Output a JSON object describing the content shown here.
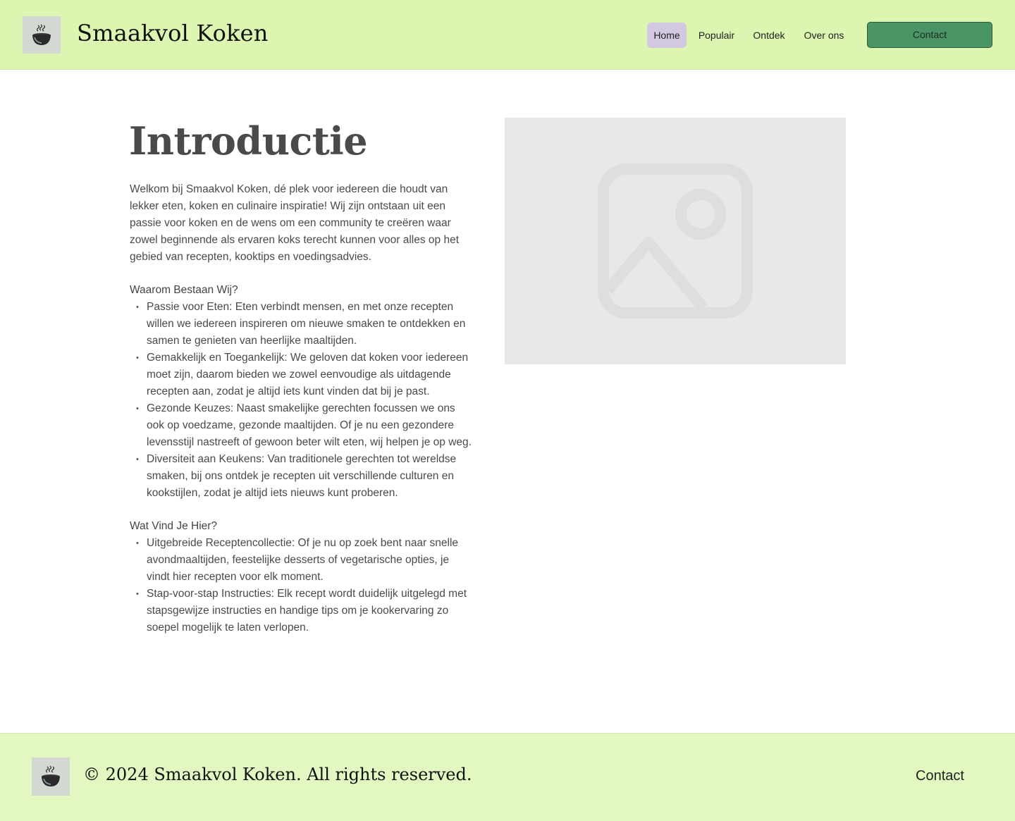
{
  "header": {
    "brand": "Smaakvol Koken",
    "logo_icon": "steaming-bowl-icon",
    "nav": [
      {
        "label": "Home",
        "active": true
      },
      {
        "label": "Populair",
        "active": false
      },
      {
        "label": "Ontdek",
        "active": false
      },
      {
        "label": "Over ons",
        "active": false
      }
    ],
    "contact_label": "Contact"
  },
  "main": {
    "title": "Introductie",
    "intro": "Welkom bij Smaakvol Koken, dé plek voor iedereen die houdt van lekker eten, koken en culinaire inspiratie! Wij zijn ontstaan uit een passie voor koken en de wens om een community te creëren waar zowel beginnende als ervaren koks terecht kunnen voor alles op het gebied van recepten, kooktips en voedingsadvies.",
    "section1": {
      "heading": "Waarom Bestaan Wij?",
      "items": [
        "Passie voor Eten: Eten verbindt mensen, en met onze recepten willen we iedereen inspireren om nieuwe smaken te ontdekken en samen te genieten van heerlijke maaltijden.",
        "Gemakkelijk en Toegankelijk: We geloven dat koken voor iedereen moet zijn, daarom bieden we zowel eenvoudige als uitdagende recepten aan, zodat je altijd iets kunt vinden dat bij je past.",
        "Gezonde Keuzes: Naast smakelijke gerechten focussen we ons ook op voedzame, gezonde maaltijden. Of je nu een gezondere levensstijl nastreeft of gewoon beter wilt eten, wij helpen je op weg.",
        "Diversiteit aan Keukens: Van traditionele gerechten tot wereldse smaken, bij ons ontdek je recepten uit verschillende culturen en kookstijlen, zodat je altijd iets nieuws kunt proberen."
      ]
    },
    "section2": {
      "heading": "Wat Vind Je Hier?",
      "items": [
        "Uitgebreide Receptencollectie: Of je nu op zoek bent naar snelle avondmaaltijden, feestelijke desserts of vegetarische opties, je vindt hier recepten voor elk moment.",
        "Stap-voor-stap Instructies: Elk recept wordt duidelijk uitgelegd met stapsgewijze instructies en handige tips om je kookervaring zo soepel mogelijk te laten verlopen."
      ]
    },
    "image_icon": "image-placeholder-icon"
  },
  "footer": {
    "copyright": "© 2024 Smaakvol Koken. All rights reserved.",
    "contact_label": "Contact",
    "logo_icon": "steaming-bowl-icon"
  },
  "colors": {
    "header_bg": "#dcf5b0",
    "footer_bg": "#e3f8c0",
    "active_nav_bg": "#d2c8e0",
    "contact_button_bg": "#4a9566"
  }
}
